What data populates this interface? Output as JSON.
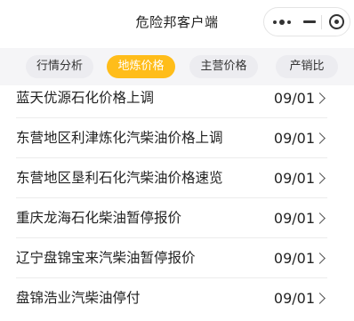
{
  "header": {
    "title": "危险邦客户端",
    "capsule": {
      "more_icon": "more-dots-icon",
      "minimize_icon": "minimize-icon",
      "close_icon": "target-close-icon"
    }
  },
  "tabs": [
    {
      "label": "行情分析",
      "active": false
    },
    {
      "label": "地炼价格",
      "active": true
    },
    {
      "label": "主营价格",
      "active": false
    },
    {
      "label": "产销比",
      "active": false
    }
  ],
  "accent_color": "#ffbd1a",
  "list": [
    {
      "title": "蓝天优源石化价格上调",
      "date": "09/01"
    },
    {
      "title": "东营地区利津炼化汽柴油价格上调",
      "date": "09/01"
    },
    {
      "title": "东营地区垦利石化汽柴油价格速览",
      "date": "09/01"
    },
    {
      "title": "重庆龙海石化柴油暂停报价",
      "date": "09/01"
    },
    {
      "title": "辽宁盘锦宝来汽柴油暂停报价",
      "date": "09/01"
    },
    {
      "title": "盘锦浩业汽柴油停付",
      "date": "09/01"
    }
  ]
}
